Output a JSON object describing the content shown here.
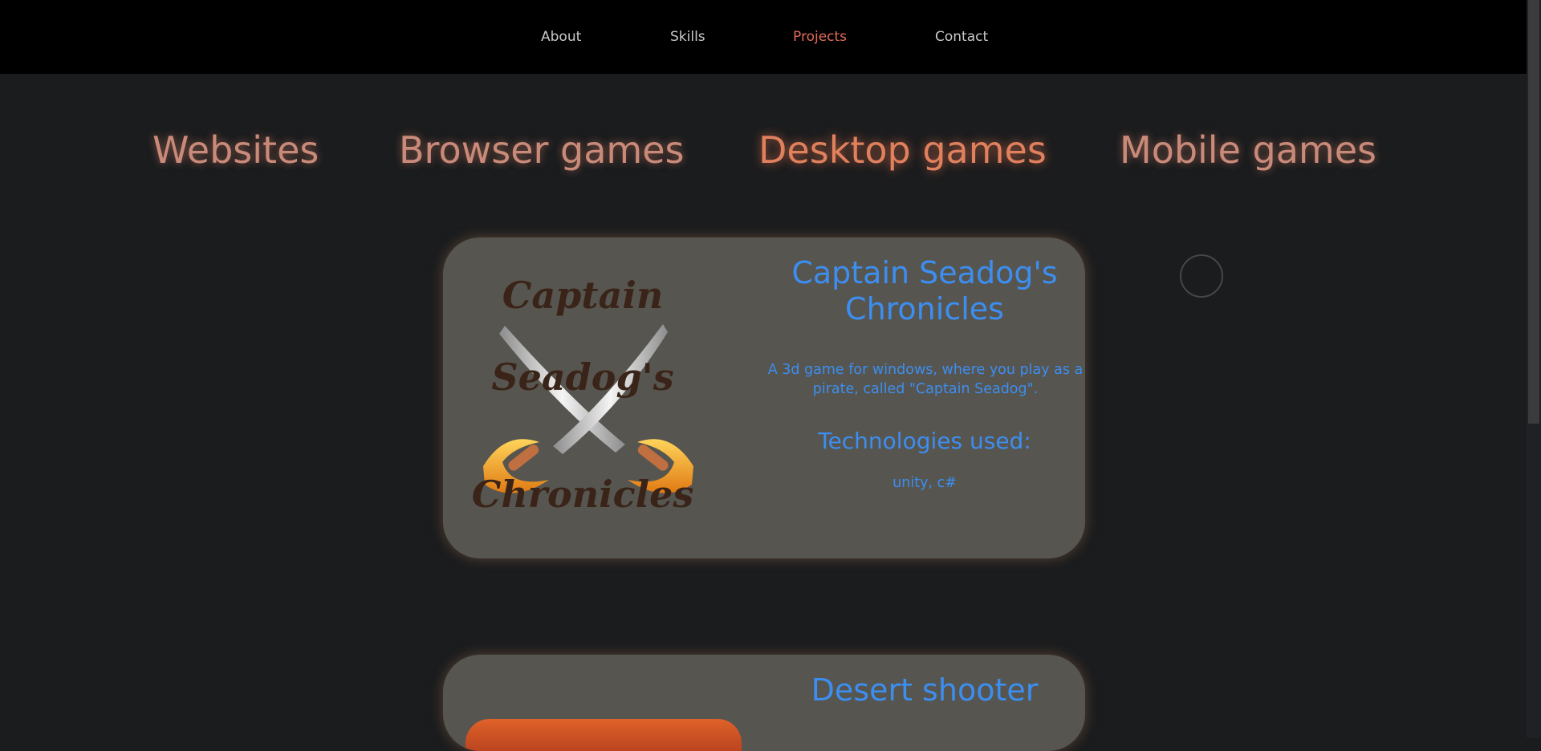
{
  "nav": {
    "items": [
      {
        "label": "About"
      },
      {
        "label": "Skills"
      },
      {
        "label": "Projects"
      },
      {
        "label": "Contact"
      }
    ],
    "active": "Projects"
  },
  "categories": {
    "items": [
      {
        "label": "Websites"
      },
      {
        "label": "Browser games"
      },
      {
        "label": "Desktop games"
      },
      {
        "label": "Mobile games"
      }
    ],
    "active": "Desktop games"
  },
  "projects": [
    {
      "title": "Captain Seadog's Chronicles",
      "logo_words": [
        "Captain",
        "Seadog's",
        "Chronicles"
      ],
      "description": "A 3d game for windows, where you play as a pirate, called \"Captain Seadog\".",
      "tech_heading": "Technologies used:",
      "technologies": "unity, c#"
    },
    {
      "title": "Desert shooter"
    }
  ],
  "colors": {
    "accent_text": "#3c8ef0",
    "active_nav": "#e06a5a",
    "category_text": "#c98a7a",
    "card_background": "#57554f"
  }
}
